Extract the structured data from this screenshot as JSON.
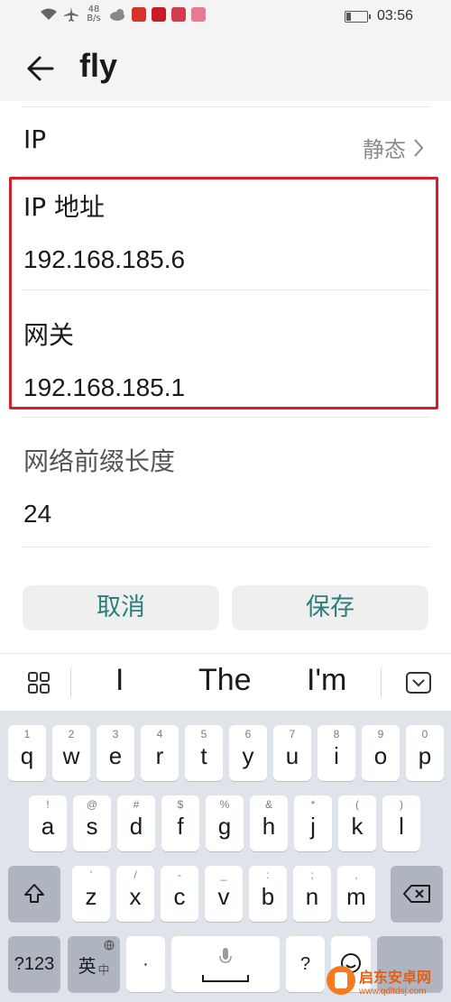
{
  "status_bar": {
    "net_speed": "48",
    "net_unit": "B/s",
    "battery_level": 0.2,
    "time": "03:56"
  },
  "app_bar": {
    "title": "fly",
    "back_icon": "arrow-left-icon"
  },
  "form": {
    "ip_label": "IP",
    "ip_mode": "静态",
    "ip_address_label": "IP 地址",
    "ip_address_value": "192.168.185.6",
    "gateway_label": "网关",
    "gateway_value": "192.168.185.1",
    "prefix_label": "网络前缀长度",
    "prefix_value": "24"
  },
  "buttons": {
    "cancel": "取消",
    "save": "保存",
    "accent": "#2a7f7a"
  },
  "suggestions": [
    "I",
    "The",
    "I'm"
  ],
  "keyboard": {
    "row1": [
      {
        "hint": "1",
        "ch": "q"
      },
      {
        "hint": "2",
        "ch": "w"
      },
      {
        "hint": "3",
        "ch": "e"
      },
      {
        "hint": "4",
        "ch": "r"
      },
      {
        "hint": "5",
        "ch": "t"
      },
      {
        "hint": "6",
        "ch": "y"
      },
      {
        "hint": "7",
        "ch": "u"
      },
      {
        "hint": "8",
        "ch": "i"
      },
      {
        "hint": "9",
        "ch": "o"
      },
      {
        "hint": "0",
        "ch": "p"
      }
    ],
    "row2": [
      {
        "hint": "!",
        "ch": "a"
      },
      {
        "hint": "@",
        "ch": "s"
      },
      {
        "hint": "#",
        "ch": "d"
      },
      {
        "hint": "$",
        "ch": "f"
      },
      {
        "hint": "%",
        "ch": "g"
      },
      {
        "hint": "&",
        "ch": "h"
      },
      {
        "hint": "*",
        "ch": "j"
      },
      {
        "hint": "(",
        "ch": "k"
      },
      {
        "hint": ")",
        "ch": "l"
      }
    ],
    "row3": [
      {
        "hint": "'",
        "ch": "z"
      },
      {
        "hint": "/",
        "ch": "x"
      },
      {
        "hint": "-",
        "ch": "c"
      },
      {
        "hint": "_",
        "ch": "v"
      },
      {
        "hint": ":",
        "ch": "b"
      },
      {
        "hint": ";",
        "ch": "n"
      },
      {
        "hint": ",",
        "ch": "m"
      }
    ],
    "sym_key": "?123",
    "lang_key": "英",
    "lang_sub": "中",
    "dot_key": "·",
    "question_key": "?",
    "shift_icon": "shift-icon",
    "backspace_icon": "backspace-icon",
    "mic_icon": "mic-icon"
  },
  "watermark": {
    "name": "启东安卓网",
    "url": "www.qdltdsj.com"
  }
}
